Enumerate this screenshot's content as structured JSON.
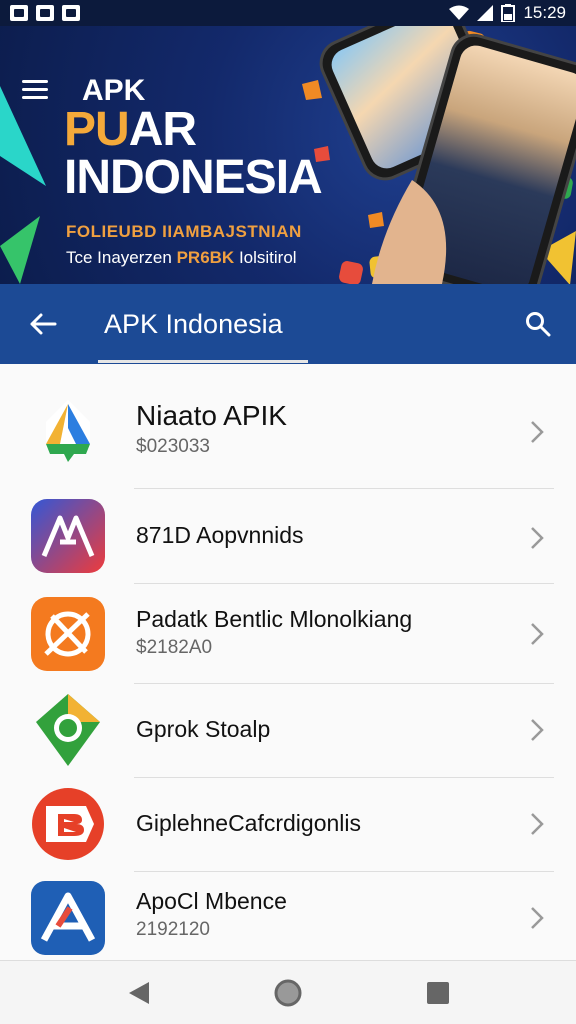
{
  "status_bar": {
    "time": "15:29"
  },
  "banner": {
    "app_label": "APK",
    "title_highlight": "PU",
    "title_rest": "AR",
    "title_line2": "INDONESIA",
    "subtitle": "FOLIEUBD IIAMBAJSTNIAN",
    "tagline_prefix": "Tce Inayerzen",
    "tagline_highlight": "PR6BK",
    "tagline_suffix": "Iolsitirol"
  },
  "appbar": {
    "title": "APK Indonesia"
  },
  "apps": [
    {
      "name": "Niaato APIK",
      "sub": "$023033"
    },
    {
      "name": "871D Aopvnnids",
      "sub": ""
    },
    {
      "name": "Padatk Bentlic Mlonolkiang",
      "sub": "$2182A0"
    },
    {
      "name": "Gprok Stoalp",
      "sub": ""
    },
    {
      "name": "GiplehneCafcrdigonlis",
      "sub": ""
    },
    {
      "name": "ApoCl Mbence",
      "sub": "2192120"
    }
  ]
}
